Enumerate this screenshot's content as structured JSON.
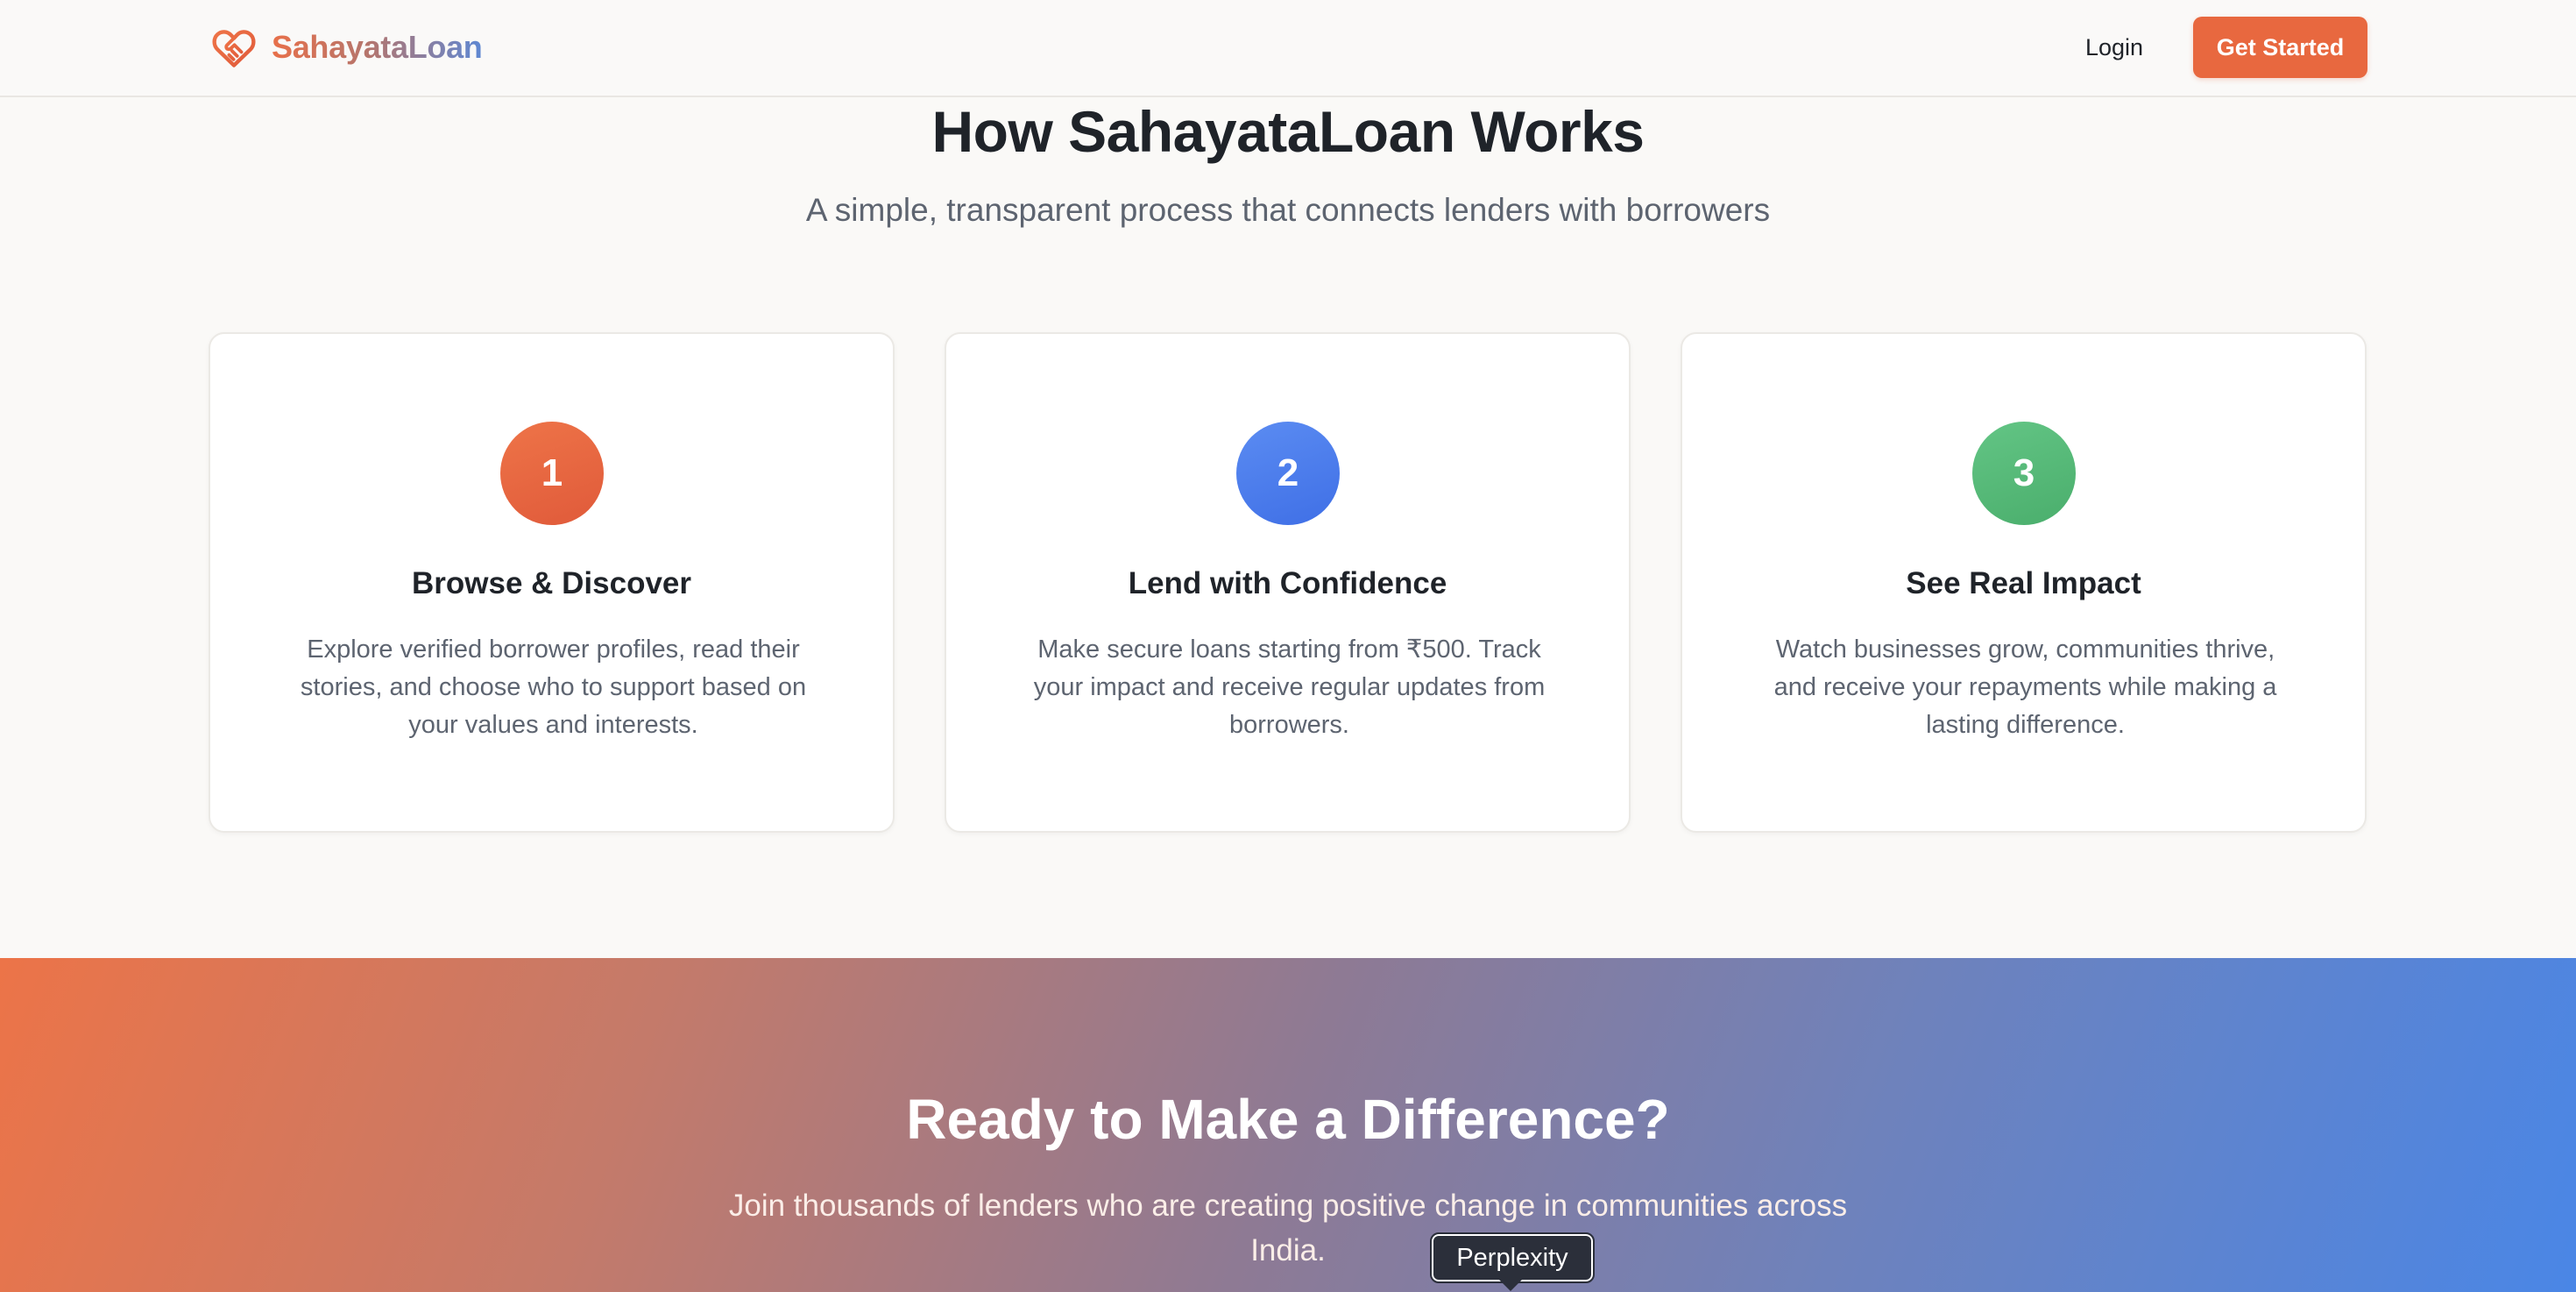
{
  "nav": {
    "brand_name": "SahayataLoan",
    "login_label": "Login",
    "cta_label": "Get Started"
  },
  "how": {
    "title": "How SahayataLoan Works",
    "subtitle": "A simple, transparent process that connects lenders with borrowers",
    "steps": [
      {
        "number": "1",
        "title": "Browse & Discover",
        "text": "Explore verified borrower profiles, read their stories, and choose who to support based on your values and interests.",
        "color": "#e8683f"
      },
      {
        "number": "2",
        "title": "Lend with Confidence",
        "text": "Make secure loans starting from ₹500. Track your impact and receive regular updates from borrowers.",
        "color": "#4a7cec"
      },
      {
        "number": "3",
        "title": "See Real Impact",
        "text": "Watch businesses grow, communities thrive, and receive your repayments while making a lasting difference.",
        "color": "#55b878"
      }
    ]
  },
  "cta": {
    "title": "Ready to Make a Difference?",
    "subtitle": "Join thousands of lenders who are creating positive change in communities across India."
  },
  "tooltip": {
    "label": "Perplexity"
  },
  "colors": {
    "brand_orange": "#e8683f",
    "brand_blue": "#4a86e6",
    "text_dark": "#1f2329",
    "text_muted": "#5d6470"
  },
  "icons": {
    "brand": "heart-handshake-icon"
  }
}
